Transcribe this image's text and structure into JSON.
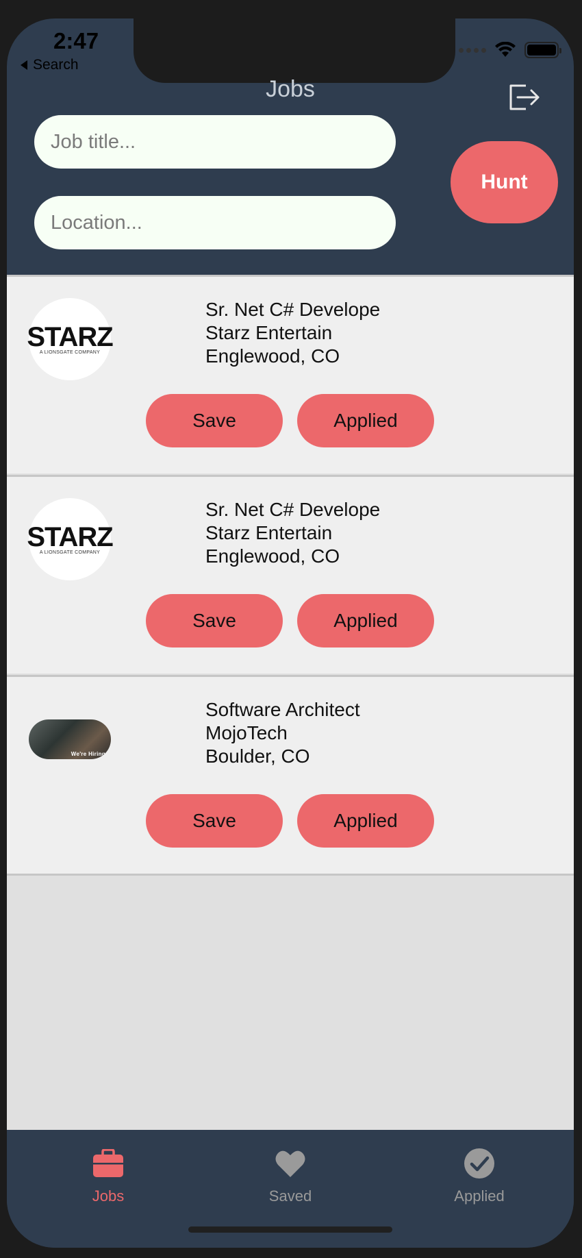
{
  "status": {
    "time": "2:47",
    "back_label": "Search"
  },
  "header": {
    "title": "Jobs",
    "job_title_placeholder": "Job title...",
    "location_placeholder": "Location...",
    "hunt_label": "Hunt"
  },
  "jobs": [
    {
      "title": "Sr. Net C# Develope",
      "company": "Starz Entertain",
      "location": "Englewood, CO",
      "logo_mark": "STARZ",
      "logo_sub": "A LIONSGATE COMPANY",
      "save_label": "Save",
      "applied_label": "Applied"
    },
    {
      "title": "Sr. Net C# Develope",
      "company": "Starz Entertain",
      "location": "Englewood, CO",
      "logo_mark": "STARZ",
      "logo_sub": "A LIONSGATE COMPANY",
      "save_label": "Save",
      "applied_label": "Applied"
    },
    {
      "title": "Software Architect",
      "company": "MojoTech",
      "location": "Boulder, CO",
      "logo_sub": "We're Hiring",
      "save_label": "Save",
      "applied_label": "Applied"
    }
  ],
  "tabs": [
    {
      "label": "Jobs",
      "icon": "briefcase-icon",
      "active": true
    },
    {
      "label": "Saved",
      "icon": "heart-icon",
      "active": false
    },
    {
      "label": "Applied",
      "icon": "checkmark-circle-icon",
      "active": false
    }
  ],
  "colors": {
    "accent": "#ec686b",
    "header_bg": "#2f3d4f",
    "inactive_tab": "#9a9a9a"
  }
}
